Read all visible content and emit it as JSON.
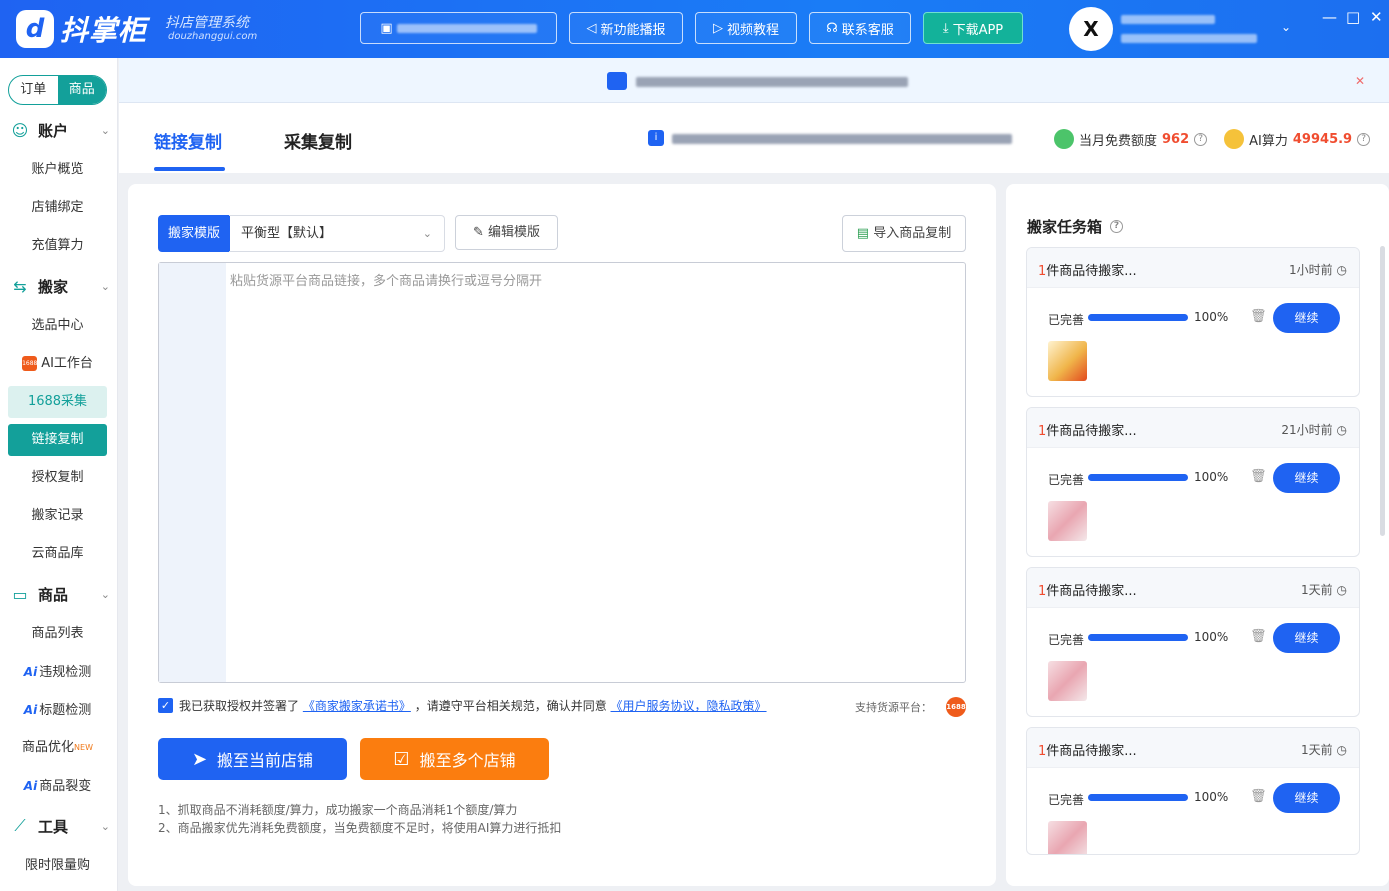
{
  "app": {
    "name": "抖掌柜",
    "subtitle": "抖店管理系统",
    "domain": "douzhanggui.com",
    "logo_mark": "d"
  },
  "topbar": {
    "buttons": [
      {
        "label": "新功能播报",
        "icon": "speaker-icon"
      },
      {
        "label": "视频教程",
        "icon": "video-icon"
      },
      {
        "label": "联系客服",
        "icon": "headset-icon"
      },
      {
        "label": "下载APP",
        "icon": "download-icon"
      }
    ],
    "win_controls": [
      "—",
      "□",
      "✕"
    ]
  },
  "sidebar": {
    "toggle": [
      "订单",
      "商品"
    ],
    "sections": [
      {
        "label": "账户",
        "items": [
          "账户概览",
          "店铺绑定",
          "充值算力"
        ]
      },
      {
        "label": "搬家",
        "items": [
          "选品中心",
          "AI工作台",
          "1688采集",
          "链接复制",
          "授权复制",
          "搬家记录",
          "云商品库"
        ]
      },
      {
        "label": "商品",
        "items": [
          "商品列表",
          "违规检测",
          "标题检测",
          "商品优化",
          "商品裂变"
        ]
      },
      {
        "label": "工具",
        "items": [
          "限时限量购"
        ]
      }
    ],
    "new_badge": "NEW",
    "badge_1688": "1688"
  },
  "tabs": [
    "链接复制",
    "采集复制"
  ],
  "quota": {
    "free_label": "当月免费额度",
    "free_value": "962",
    "ai_label": "AI算力",
    "ai_value": "49945.9",
    "help": "?"
  },
  "form": {
    "template_label": "搬家模版",
    "template_value": "平衡型【默认】",
    "edit_label": "编辑模版",
    "import_label": "导入商品复制",
    "placeholder": "粘贴货源平台商品链接，多个商品请换行或逗号分隔开",
    "agree_prefix": "我已获取授权并签署了",
    "agree_link1": "《商家搬家承诺书》",
    "agree_middle": "，请遵守平台相关规范，确认并同意",
    "agree_link2": "《用户服务协议，隐私政策》",
    "support_label": "支持货源平台：",
    "btn_current": "搬至当前店铺",
    "btn_multi": "搬至多个店铺",
    "note1": "1、抓取商品不消耗额度/算力，成功搬家一个商品消耗1个额度/算力",
    "note2": "2、商品搬家优先消耗免费额度，当免费额度不足时，将使用AI算力进行抵扣"
  },
  "panel": {
    "title": "搬家任务箱",
    "tasks": [
      {
        "count": "1",
        "title": "件商品待搬家...",
        "time": "1小时前",
        "status": "已完善",
        "progress": 1.0,
        "pct": "100%",
        "action": "继续",
        "thumb": "food"
      },
      {
        "count": "1",
        "title": "件商品待搬家...",
        "time": "21小时前",
        "status": "已完善",
        "progress": 1.0,
        "pct": "100%",
        "action": "继续",
        "thumb": "pink"
      },
      {
        "count": "1",
        "title": "件商品待搬家...",
        "time": "1天前",
        "status": "已完善",
        "progress": 1.0,
        "pct": "100%",
        "action": "继续",
        "thumb": "pink"
      },
      {
        "count": "1",
        "title": "件商品待搬家...",
        "time": "1天前",
        "status": "已完善",
        "progress": 1.0,
        "pct": "100%",
        "action": "继续",
        "thumb": "pink"
      }
    ]
  },
  "colors": {
    "primary": "#1f63f2",
    "teal": "#13a09a",
    "orange": "#fb7d0f",
    "red": "#f04d30"
  }
}
